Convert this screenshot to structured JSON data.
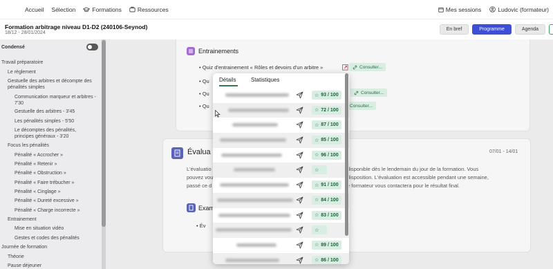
{
  "nav": {
    "items": [
      {
        "label": "Accueil"
      },
      {
        "label": "Sélection"
      },
      {
        "label": "Formations"
      },
      {
        "label": "Ressources"
      }
    ],
    "sessions_label": "Mes sessions",
    "user_label": "Ludovic (formateur)"
  },
  "course": {
    "title": "Formation arbitrage niveau D1-D2 (240106-Seynod)",
    "dates": "18/12 - 28/01/2024",
    "views": [
      "En bref",
      "Programme",
      "Agenda"
    ]
  },
  "sidebar": {
    "condense_label": "Condensé",
    "items": [
      "Travail préparatoire",
      "Le règlement",
      "Gestuelle des arbitres et décompte des pénalités simples",
      "Communication marqueur et arbitres - 7'30",
      "Gestuelle des arbitres - 3'45",
      "Les pénalités simples - 5'50",
      "Le décomptes des pénalités, principes généraux - 3'20",
      "Focus les pénalités",
      "Pénalité « Accrocher »",
      "Pénalité « Retenir »",
      "Pénalité « Obstruction »",
      "Pénalité « Faire trébucher »",
      "Pénalité « Cinglage »",
      "Pénalité « Dureté excessive »",
      "Pénalité « Charge incorrecte »",
      "Entrainement",
      "Mise en situation vidéo",
      "Gestes et codes des pénalités",
      "Journée de formation",
      "Théorie",
      "Pause déjeuner"
    ]
  },
  "main": {
    "entrainements_title": "Entrainements",
    "quiz_label": "Quiz d'entrainement « Rôles et devoirs d'un arbitre »",
    "qu_fragment": "Qu",
    "consult_label": "Consulter...",
    "evaluation_title": "Évalua",
    "evaluation_dates": "07/01 - 14/01",
    "eval_left": [
      "L'évaluatio",
      "pouvez vou",
      "passé ce d"
    ],
    "eval_right": [
      "disponible dès le lendemain du jour de la formation. Vous",
      "disposition. L'évaluation est accessible pendant une semaine,",
      "e formateur vous contactera pour le résultat final."
    ],
    "exam_title": "Exam",
    "exam_bullet": "Év"
  },
  "popup": {
    "tabs": [
      "Détails",
      "Statistiques"
    ],
    "scores": [
      "93 / 100",
      "72 / 100",
      "87 / 100",
      "85 / 100",
      "96 / 100",
      "",
      "91 / 100",
      "84 / 100",
      "83 / 100",
      "",
      "89 / 100",
      "86 / 100"
    ]
  },
  "colors": {
    "primary": "#3d4fd6",
    "score_bg": "#d9eee3",
    "score_text": "#1f5e39",
    "section_icon_purple": "#a46bd1",
    "section_icon_blue": "#5a63b8"
  },
  "icons": [
    "graduation-cap-icon",
    "briefcase-icon",
    "calendar-icon",
    "user-icon",
    "list-icon",
    "document-icon",
    "external-link-icon",
    "link-icon",
    "send-icon",
    "star-icon",
    "cursor-icon"
  ]
}
